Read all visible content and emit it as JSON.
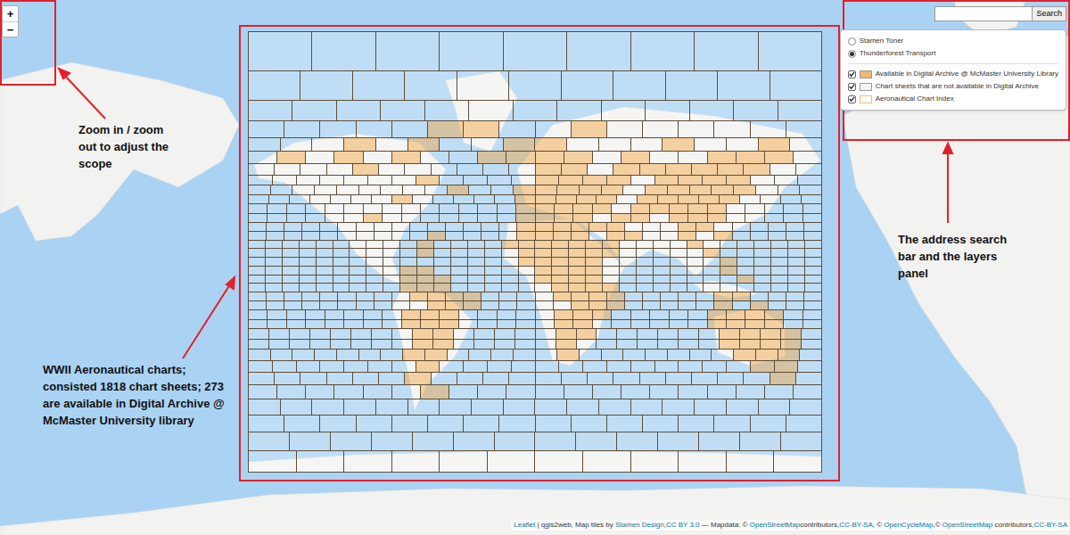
{
  "zoom_controls": [
    {
      "label": "+"
    },
    {
      "label": "−"
    }
  ],
  "search": {
    "button": "Search"
  },
  "base_layers": [
    {
      "label": "Stamen Toner",
      "selected": false
    },
    {
      "label": "Thunderforest Transport",
      "selected": true
    }
  ],
  "overlays": [
    {
      "label": "Available in Digital Archive @ McMaster University Library",
      "checked": true,
      "color": "#f5b870",
      "kind": "fill"
    },
    {
      "label": "Chart sheets that are not available in Digital Archive",
      "checked": true,
      "color": "#f4f4f4",
      "kind": "fill"
    },
    {
      "label": "Aeronautical Chart Index",
      "checked": true,
      "color": "#f5b870",
      "kind": "outline"
    }
  ],
  "annotations": [
    {
      "text": "Zoom in / zoom out to adjust the scope"
    },
    {
      "text": "WWII Aeronautical charts; consisted 1818 chart sheets; 273 are available in Digital Archive @ McMaster University library"
    },
    {
      "text": "The address search bar and the layers panel"
    }
  ],
  "chart_grid": {
    "rows": [
      {
        "cells": 9,
        "available": []
      },
      {
        "cells": 11,
        "available": []
      },
      {
        "cells": 13,
        "available": []
      },
      {
        "cells": 16,
        "available": [
          5,
          6,
          9
        ]
      },
      {
        "cells": 18,
        "available": [
          3,
          5,
          8,
          9,
          13,
          16
        ]
      },
      {
        "cells": 20,
        "available": [
          1,
          3,
          5,
          8,
          9,
          10,
          11,
          13,
          16,
          17,
          18
        ]
      },
      {
        "cells": 22,
        "available": [
          4,
          11,
          12,
          14,
          15,
          16,
          17,
          18,
          19
        ]
      },
      {
        "cells": 24,
        "available": [
          7,
          12,
          13,
          14,
          15,
          17,
          18,
          19,
          20
        ]
      },
      {
        "cells": 26,
        "available": [
          9,
          12,
          13,
          14,
          15,
          16,
          18,
          19,
          20,
          21,
          22
        ]
      },
      {
        "cells": 28,
        "available": [
          7,
          13,
          14,
          15,
          16,
          17,
          19,
          20,
          21,
          22,
          23
        ]
      },
      {
        "cells": 30,
        "available": [
          14,
          15,
          16,
          17,
          18,
          20,
          21,
          22,
          23,
          24
        ]
      },
      {
        "cells": 30,
        "available": [
          6,
          14,
          15,
          16,
          17,
          19,
          20,
          22,
          23,
          24
        ]
      },
      {
        "cells": 32,
        "available": [
          15,
          16,
          17,
          18,
          19,
          20,
          24,
          25
        ]
      },
      {
        "cells": 32,
        "available": [
          10,
          15,
          16,
          17,
          18,
          20,
          21,
          24,
          26
        ]
      },
      {
        "cells": 34,
        "available": [
          10,
          15,
          16,
          17,
          18,
          19,
          20,
          21,
          26
        ]
      },
      {
        "cells": 34,
        "available": [
          10,
          16,
          17,
          18,
          19,
          20,
          21,
          27
        ]
      },
      {
        "cells": 34,
        "available": [
          16,
          17,
          18,
          19,
          20,
          28
        ]
      },
      {
        "cells": 34,
        "available": [
          9,
          10,
          17,
          18,
          19,
          20,
          28
        ]
      },
      {
        "cells": 34,
        "available": [
          9,
          10,
          11,
          17,
          18,
          19,
          20,
          29
        ]
      },
      {
        "cells": 34,
        "available": [
          9,
          10,
          11,
          18,
          19,
          20,
          21
        ]
      },
      {
        "cells": 32,
        "available": [
          9,
          10,
          11,
          12,
          17,
          18,
          19,
          20,
          26,
          27
        ]
      },
      {
        "cells": 32,
        "available": [
          10,
          11,
          12,
          18,
          19,
          20,
          26,
          28
        ]
      },
      {
        "cells": 30,
        "available": [
          8,
          9,
          10,
          16,
          17,
          18,
          24,
          25,
          26,
          27
        ]
      },
      {
        "cells": 30,
        "available": [
          8,
          9,
          10,
          16,
          17,
          24,
          25,
          26,
          27
        ]
      },
      {
        "cells": 28,
        "available": [
          8,
          9,
          15,
          16,
          23,
          24,
          25,
          26
        ]
      },
      {
        "cells": 28,
        "available": [
          8,
          9,
          15,
          23,
          24,
          25,
          26
        ]
      },
      {
        "cells": 26,
        "available": [
          7,
          8,
          14,
          22,
          23,
          24
        ]
      },
      {
        "cells": 24,
        "available": [
          7,
          21,
          22
        ]
      },
      {
        "cells": 22,
        "available": [
          6,
          20
        ]
      },
      {
        "cells": 20,
        "available": [
          6
        ]
      },
      {
        "cells": 18,
        "available": []
      },
      {
        "cells": 16,
        "available": []
      },
      {
        "cells": 14,
        "available": []
      },
      {
        "cells": 12,
        "available": []
      }
    ]
  },
  "attribution": [
    {
      "text": "Leaflet",
      "link": true
    },
    {
      "text": " | qgis2web, Map tiles by ",
      "link": false
    },
    {
      "text": "Stamen Design",
      "link": true
    },
    {
      "text": ",",
      "link": false
    },
    {
      "text": "CC BY 3.0",
      "link": true
    },
    {
      "text": " — Mapdata: © ",
      "link": false
    },
    {
      "text": "OpenStreetMap",
      "link": true
    },
    {
      "text": "contributors,",
      "link": false
    },
    {
      "text": "CC-BY-SA",
      "link": true
    },
    {
      "text": ", © ",
      "link": false
    },
    {
      "text": "OpenCycleMap",
      "link": true
    },
    {
      "text": ",© ",
      "link": false
    },
    {
      "text": "OpenStreetMap",
      "link": true
    },
    {
      "text": " contributors,",
      "link": false
    },
    {
      "text": "CC-BY-SA",
      "link": true
    }
  ]
}
